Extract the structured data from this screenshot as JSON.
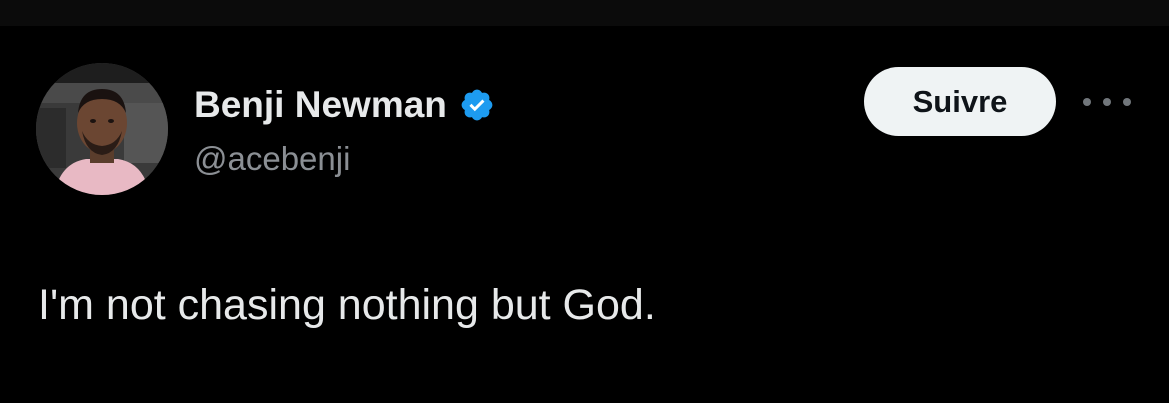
{
  "tweet": {
    "author": {
      "display_name": "Benji Newman",
      "handle": "@acebenji",
      "verified": true
    },
    "follow_label": "Suivre",
    "text": "I'm not chasing nothing but God."
  },
  "colors": {
    "background": "#000000",
    "text_primary": "#e7e9ea",
    "text_secondary": "#71767b",
    "verified_badge": "#1d9bf0",
    "follow_button_bg": "#eff3f4",
    "follow_button_text": "#0f1419"
  },
  "icons": {
    "verified": "verified-badge-icon",
    "more": "more-horizontal-icon"
  }
}
